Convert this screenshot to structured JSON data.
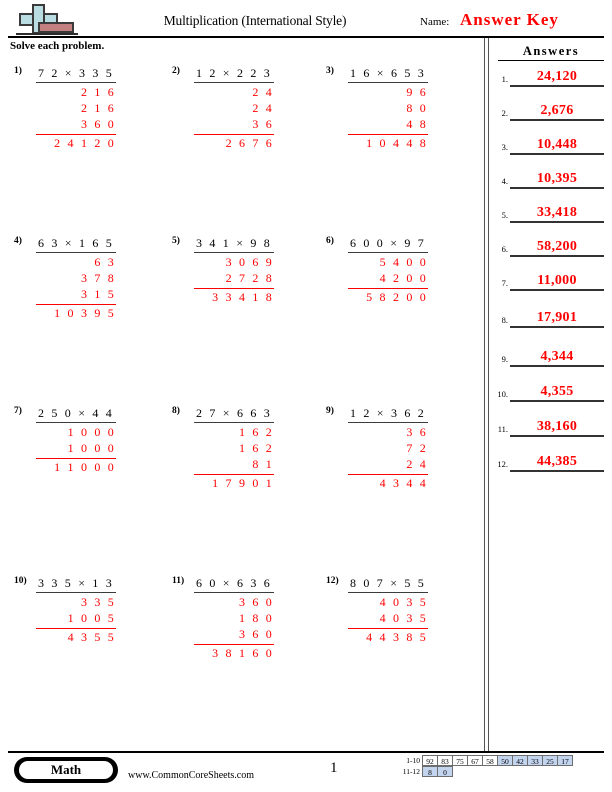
{
  "header": {
    "title": "Multiplication (International Style)",
    "name_label": "Name:",
    "name_value": "Answer Key",
    "instructions": "Solve each problem.",
    "logo_icon": "math-plus-logo-icon",
    "answer_color": "#ff0000"
  },
  "answers_panel": {
    "heading": "Answers",
    "items": [
      {
        "num": "1.",
        "value": "24,120"
      },
      {
        "num": "2.",
        "value": "2,676"
      },
      {
        "num": "3.",
        "value": "10,448"
      },
      {
        "num": "4.",
        "value": "10,395"
      },
      {
        "num": "5.",
        "value": "33,418"
      },
      {
        "num": "6.",
        "value": "58,200"
      },
      {
        "num": "7.",
        "value": "11,000"
      },
      {
        "num": "8.",
        "value": "17,901"
      },
      {
        "num": "9.",
        "value": "4,344"
      },
      {
        "num": "10.",
        "value": "4,355"
      },
      {
        "num": "11.",
        "value": "38,160"
      },
      {
        "num": "12.",
        "value": "44,385"
      }
    ]
  },
  "problems": [
    {
      "num": "1)",
      "equation": "7 2 × 3 3 5",
      "partials": [
        "2 1 6",
        "2 1 6",
        "3 6 0"
      ],
      "total": "2 4 1 2 0"
    },
    {
      "num": "2)",
      "equation": "1 2 × 2 2 3",
      "partials": [
        "2 4",
        "2 4",
        "3 6"
      ],
      "total": "2 6 7 6"
    },
    {
      "num": "3)",
      "equation": "1 6 × 6 5 3",
      "partials": [
        "9 6",
        "8 0",
        "4 8"
      ],
      "total": "1 0 4 4 8"
    },
    {
      "num": "4)",
      "equation": "6 3 × 1 6 5",
      "partials": [
        "6 3",
        "3 7 8",
        "3 1 5"
      ],
      "total": "1 0 3 9 5"
    },
    {
      "num": "5)",
      "equation": "3 4 1 × 9 8",
      "partials": [
        "3 0 6 9",
        "2 7 2 8"
      ],
      "total": "3 3 4 1 8"
    },
    {
      "num": "6)",
      "equation": "6 0 0 × 9 7",
      "partials": [
        "5 4 0 0",
        "4 2 0 0"
      ],
      "total": "5 8 2 0 0"
    },
    {
      "num": "7)",
      "equation": "2 5 0 × 4 4",
      "partials": [
        "1 0 0 0",
        "1 0 0 0"
      ],
      "total": "1 1 0 0 0"
    },
    {
      "num": "8)",
      "equation": "2 7 × 6 6 3",
      "partials": [
        "1 6 2",
        "1 6 2",
        "8 1"
      ],
      "total": "1 7 9 0 1"
    },
    {
      "num": "9)",
      "equation": "1 2 × 3 6 2",
      "partials": [
        "3 6",
        "7 2",
        "2 4"
      ],
      "total": "4 3 4 4"
    },
    {
      "num": "10)",
      "equation": "3 3 5 × 1 3",
      "partials": [
        "3 3 5",
        "1 0 0 5"
      ],
      "total": "4 3 5 5"
    },
    {
      "num": "11)",
      "equation": "6 0 × 6 3 6",
      "partials": [
        "3 6 0",
        "1 8 0",
        "3 6 0"
      ],
      "total": "3 8 1 6 0"
    },
    {
      "num": "12)",
      "equation": "8 0 7 × 5 5",
      "partials": [
        "4 0 3 5",
        "4 0 3 5"
      ],
      "total": "4 4 3 8 5"
    }
  ],
  "footer": {
    "subject_badge": "Math",
    "website": "www.CommonCoreSheets.com",
    "page_number": "1",
    "score_grid": {
      "row1_label": "1-10",
      "row1": [
        {
          "value": "92",
          "highlight": false
        },
        {
          "value": "83",
          "highlight": false
        },
        {
          "value": "75",
          "highlight": false
        },
        {
          "value": "67",
          "highlight": false
        },
        {
          "value": "58",
          "highlight": false
        },
        {
          "value": "50",
          "highlight": true
        },
        {
          "value": "42",
          "highlight": true
        },
        {
          "value": "33",
          "highlight": true
        },
        {
          "value": "25",
          "highlight": true
        },
        {
          "value": "17",
          "highlight": true
        }
      ],
      "row2_label": "11-12",
      "row2": [
        {
          "value": "8",
          "highlight": true
        },
        {
          "value": "0",
          "highlight": true
        }
      ],
      "highlight_color": "#c3d4ef"
    }
  }
}
